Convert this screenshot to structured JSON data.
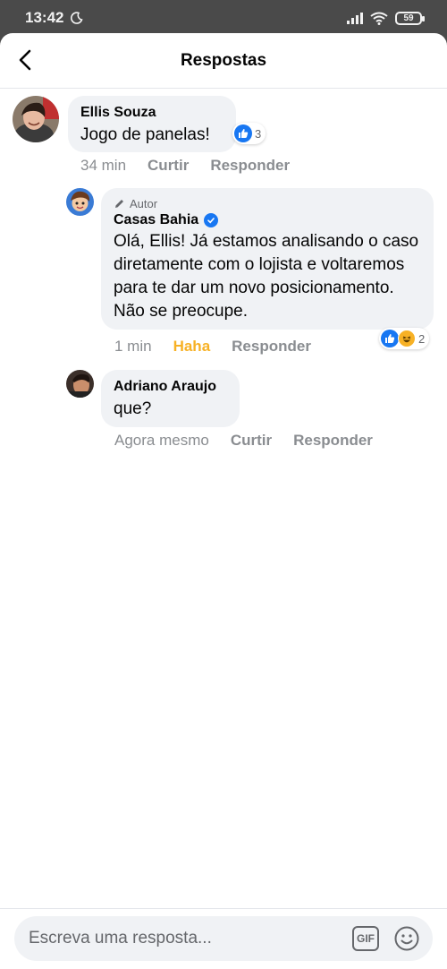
{
  "status_bar": {
    "time": "13:42",
    "battery": "59"
  },
  "header": {
    "title": "Respostas"
  },
  "comments": [
    {
      "author": "Ellis Souza",
      "text": "Jogo de panelas!",
      "time": "34 min",
      "actions": [
        "Curtir",
        "Responder"
      ],
      "reaction_count": "3"
    },
    {
      "badge": "Autor",
      "author": "Casas Bahia",
      "text": "Olá, Ellis! Já estamos analisando o caso diretamente com o lojista e voltaremos para te dar um novo posicionamento. Não se preocupe.",
      "time": "1 min",
      "actions": [
        "Haha",
        "Responder"
      ],
      "reaction_count": "2"
    },
    {
      "author": "Adriano Araujo",
      "text": "que?",
      "time": "Agora mesmo",
      "actions": [
        "Curtir",
        "Responder"
      ]
    }
  ],
  "composer": {
    "placeholder": "Escreva uma resposta...",
    "gif_label": "GIF"
  },
  "colors": {
    "accent": "#1877f2",
    "haha": "#f7b125",
    "bubble": "#f0f2f5"
  }
}
